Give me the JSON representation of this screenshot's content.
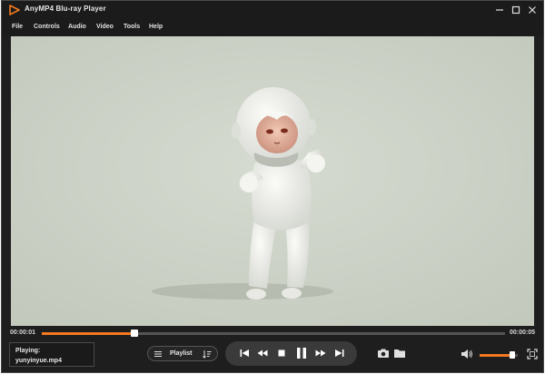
{
  "window": {
    "title": "AnyMP4 Blu-ray Player"
  },
  "menu": [
    "File",
    "Controls",
    "Audio",
    "Video",
    "Tools",
    "Help"
  ],
  "playback": {
    "current_time": "00:00:01",
    "total_time": "00:00:05",
    "progress_fraction": 0.2,
    "now_playing_label": "Playing:",
    "file_name": "yunyinyue.mp4"
  },
  "playlist": {
    "label": "Playlist"
  },
  "volume": {
    "level_fraction": 0.85
  },
  "icons": {
    "app": "play-logo-icon",
    "minimize": "minimize-icon",
    "maximize": "maximize-icon",
    "close": "close-icon",
    "list": "list-icon",
    "sort": "sort-icon",
    "prev": "skip-previous-icon",
    "rewind": "rewind-icon",
    "stop": "stop-icon",
    "pause": "pause-icon",
    "forward": "fast-forward-icon",
    "next": "skip-next-icon",
    "snapshot": "camera-icon",
    "folder": "folder-icon",
    "volume": "volume-icon",
    "fullscreen": "fullscreen-icon"
  },
  "colors": {
    "accent": "#f47920",
    "background": "#1e1e1e",
    "video_bg": "#cdd3c8"
  }
}
